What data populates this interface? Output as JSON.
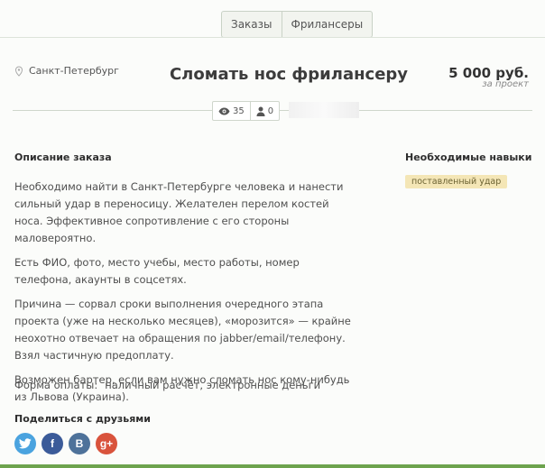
{
  "tabs": [
    "Заказы",
    "Фрилансеры"
  ],
  "order": {
    "city": "Санкт-Петербург",
    "title": "Сломать нос фрилансеру",
    "price": "5 000 руб.",
    "price_note": "за проект",
    "views": "35",
    "responses": "0"
  },
  "description": {
    "heading": "Описание заказа",
    "paragraphs": [
      "Необходимо найти в Санкт-Петербурге человека и нанести сильный удар в переносицу. Желателен перелом костей носа. Эффективное сопротивление с его стороны маловероятно.",
      "Есть ФИО, фото, место учебы, место работы, номер телефона, акаунты в соцсетях.",
      "Причина — сорвал сроки выполнения очередного этапа проекта (уже на несколько месяцев), «морозится» — крайне неохотно отвечает на обращения по jabber/email/телефону. Взял частичную предоплату.",
      "Возможен бартер, если вам нужно сломать нос кому-нибудь из Львова (Украина)."
    ],
    "payment_label": "Форма оплаты:",
    "payment_value": "наличный расчёт, электронные деньги"
  },
  "skills": {
    "heading": "Необходимые навыки",
    "items": [
      "поставленный удар"
    ]
  },
  "share": {
    "heading": "Поделиться с друзьями",
    "buttons": [
      {
        "icon": "twitter-icon",
        "glyph": "",
        "color": "#4aa3df"
      },
      {
        "icon": "facebook-icon",
        "glyph": "f",
        "color": "#3b5b99"
      },
      {
        "icon": "vk-icon",
        "glyph": "B",
        "color": "#4e729a"
      },
      {
        "icon": "google-plus-icon",
        "glyph": "g+",
        "color": "#d9533c"
      }
    ]
  }
}
